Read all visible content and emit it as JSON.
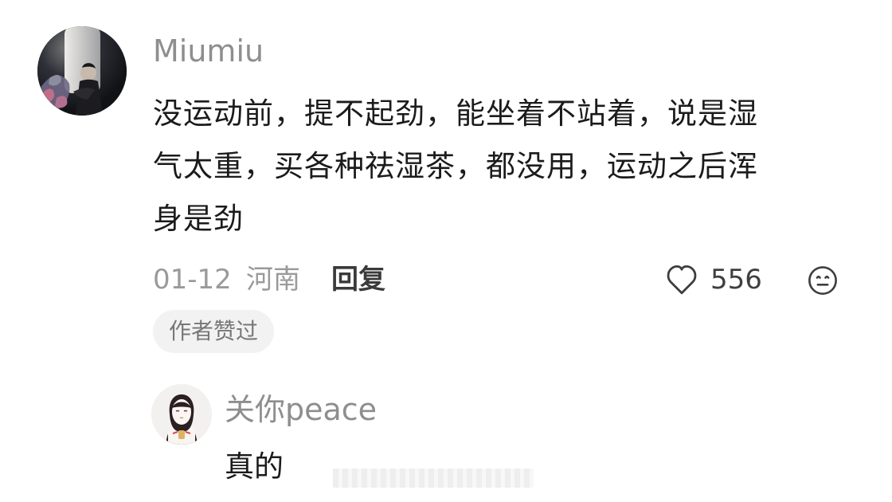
{
  "main_comment": {
    "username": "Miumiu",
    "text_line_1": "没运动前，提不起劲，能坐着不站着，说是湿",
    "text_line_2": "气太重，买各种祛湿茶，都没用，运动之后浑",
    "text_line_3": "身是劲",
    "date": "01-12",
    "region": "河南",
    "reply_label": "回复",
    "like_count": "556",
    "author_badge": "作者赞过",
    "icons": {
      "like": "heart-icon",
      "emoji": "emoji-icon",
      "avatar": "avatar"
    }
  },
  "reply_comment": {
    "username": "关你peace",
    "text": "真的",
    "icons": {
      "avatar": "avatar"
    }
  },
  "colors": {
    "text": "#1b1b1b",
    "muted": "#8e8e8e",
    "badge_bg": "#f2f2f2"
  }
}
